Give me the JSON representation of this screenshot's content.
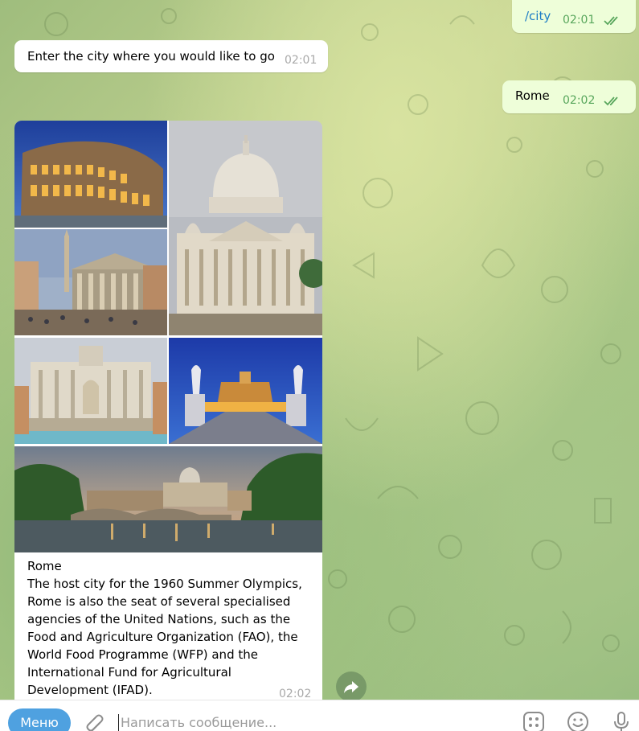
{
  "messages": [
    {
      "text": "/city",
      "time": "02:01",
      "direction": "out"
    },
    {
      "text": "Enter the city where you would like to go",
      "time": "02:01",
      "direction": "in"
    },
    {
      "text": "Rome",
      "time": "02:02",
      "direction": "out"
    }
  ],
  "album": {
    "photos": [
      "colosseum",
      "st-peters-basilica",
      "pantheon",
      "trevi-fountain",
      "castel-sant-angelo",
      "tiber-river-panorama"
    ],
    "caption": [
      "Rome",
      "The host city for the 1960 Summer Olympics,",
      "Rome is also the seat of several specialised",
      "agencies of the United Nations, such as the",
      "Food and Agriculture Organization (FAO), the",
      "World Food Programme (WFP) and the",
      "International Fund for Agricultural",
      "Development (IFAD)."
    ],
    "time": "02:02"
  },
  "composer": {
    "menu_label": "Меню",
    "placeholder": "Написать сообщение..."
  },
  "icons": [
    "double-check-icon",
    "share-icon",
    "attach-icon",
    "bot-commands-icon",
    "emoji-icon",
    "microphone-icon"
  ],
  "colors": {
    "outgoing_bubble": "#eefed9",
    "incoming_bubble": "#ffffff",
    "accent": "#4fa1e0",
    "check_green": "#58a65c"
  }
}
